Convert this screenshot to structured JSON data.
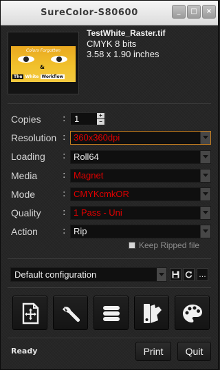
{
  "window": {
    "title": "SureColor-S80600",
    "minimize": "_",
    "maximize": "□",
    "close": "×"
  },
  "thumbnail": {
    "line1": "Colors Forgotten",
    "line2": "&",
    "line3_left": "The",
    "line3_mid": "White",
    "line3_right": "Workflow"
  },
  "file": {
    "name": "TestWhite_Raster.tif",
    "colorspace": "CMYK 8 bits",
    "size": "3.58 x 1.90 inches"
  },
  "settings": {
    "copies": {
      "label": "Copies",
      "value": "1"
    },
    "resolution": {
      "label": "Resolution",
      "value": "360x360dpi"
    },
    "loading": {
      "label": "Loading",
      "value": "Roll64"
    },
    "media": {
      "label": "Media",
      "value": "Magnet"
    },
    "mode": {
      "label": "Mode",
      "value": "CMYKcmkOR"
    },
    "quality": {
      "label": "Quality",
      "value": "1 Pass - Uni"
    },
    "action": {
      "label": "Action",
      "value": "Rip"
    },
    "colon": ":"
  },
  "keep_ripped": {
    "label": "Keep Ripped file",
    "checked": false
  },
  "configuration": {
    "value": "Default configuration",
    "more": "..."
  },
  "toolbar_icons": [
    "layout-icon",
    "wrench-icon",
    "stack-icon",
    "color-swatch-icon",
    "palette-icon"
  ],
  "status": {
    "text": "Ready"
  },
  "buttons": {
    "print": "Print",
    "quit": "Quit"
  },
  "colors": {
    "accent_red": "#e20000",
    "focus_orange": "#c67e1e",
    "background": "#262626"
  }
}
